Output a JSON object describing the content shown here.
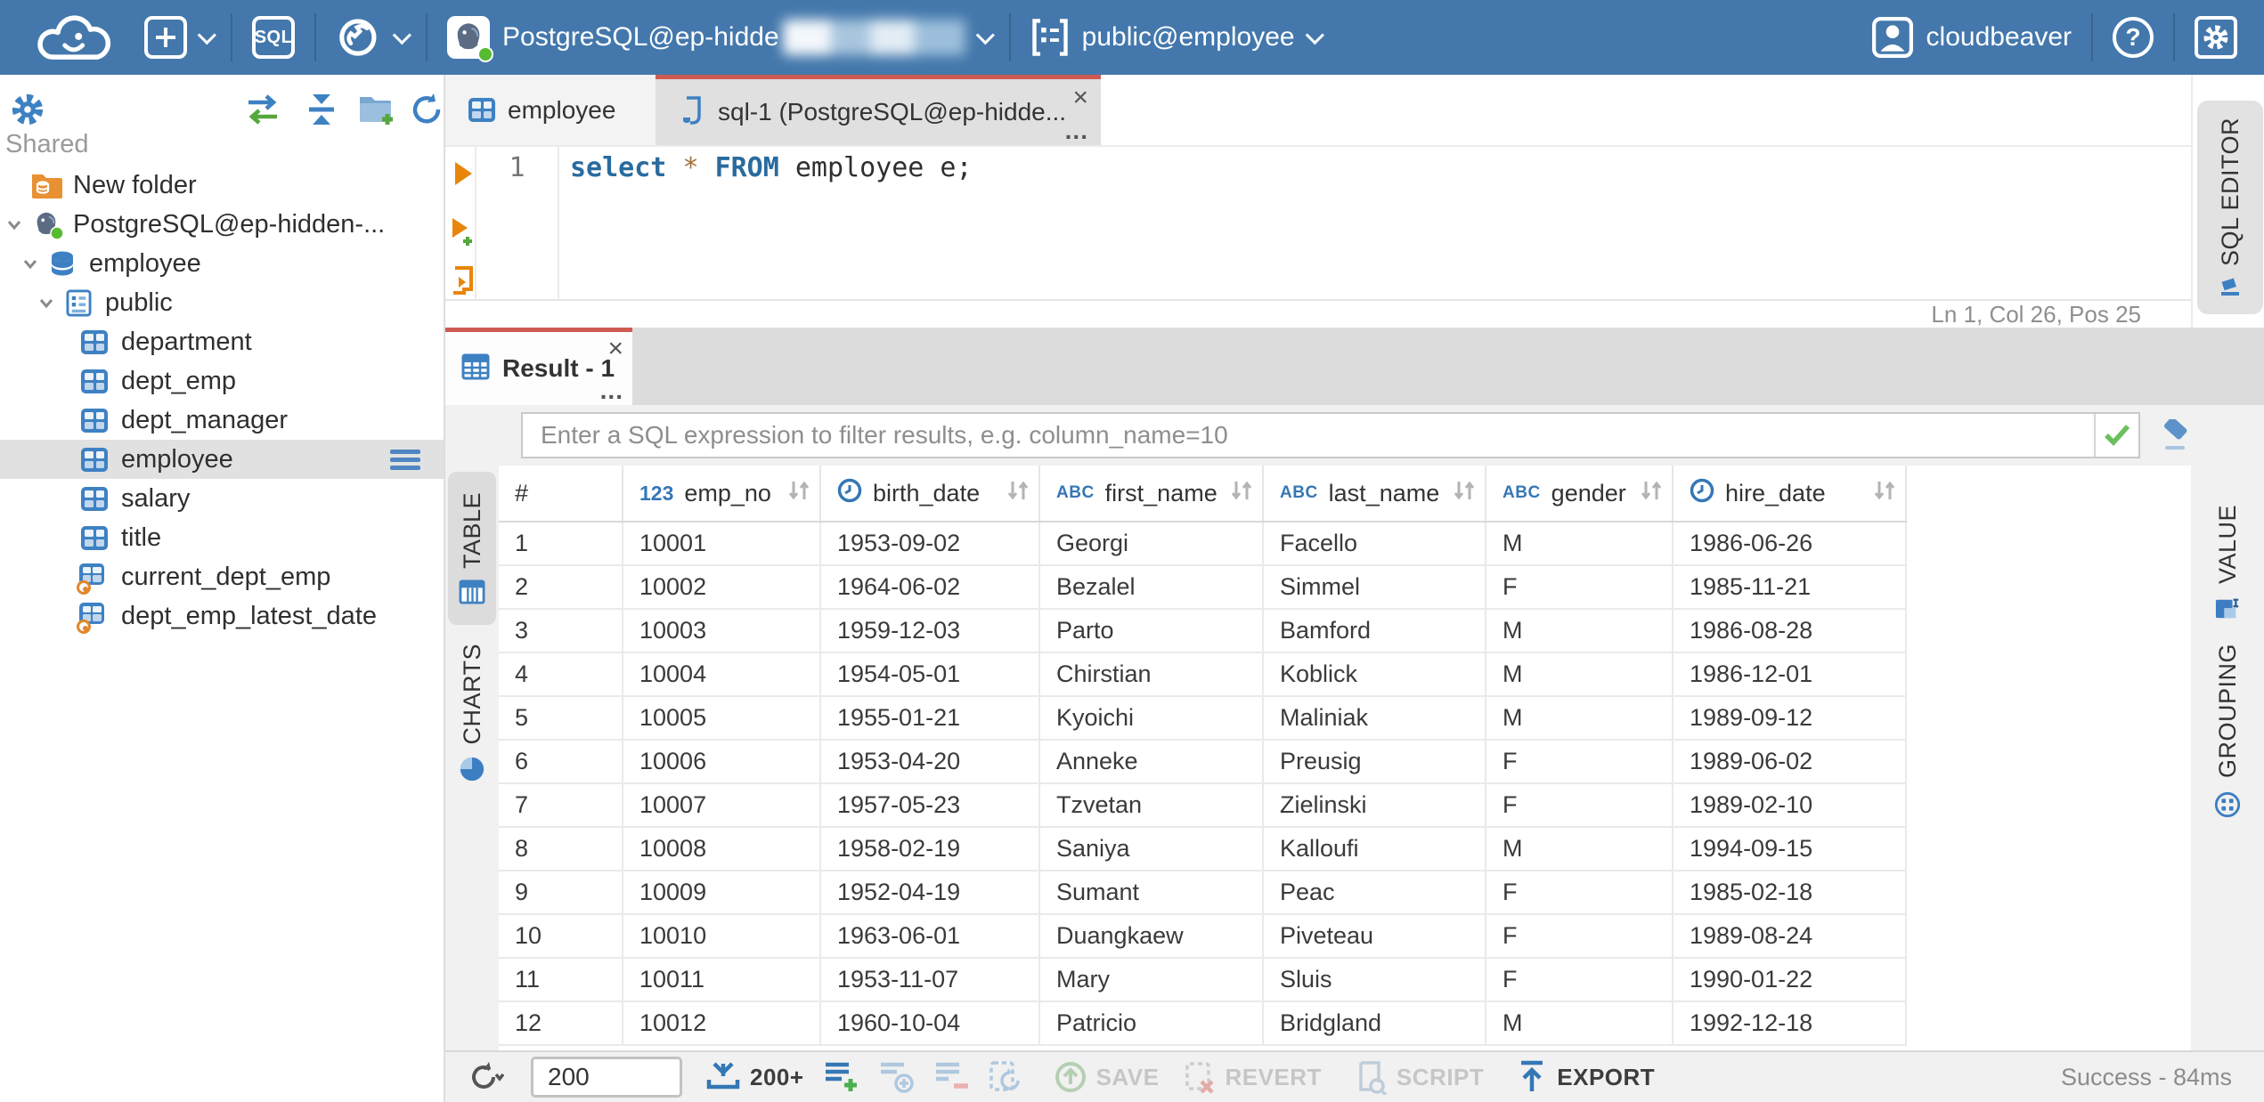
{
  "ui": {
    "close": "×",
    "more": "..."
  },
  "topbar": {
    "sql_button": "SQL",
    "connection_name": "PostgreSQL@ep-hidde",
    "schema_selector": "public@employee",
    "username": "cloudbeaver",
    "help": "?"
  },
  "sidebar": {
    "section": "Shared",
    "tree": [
      {
        "label": "New folder"
      },
      {
        "label": "PostgreSQL@ep-hidden-..."
      },
      {
        "label": "employee"
      },
      {
        "label": "public"
      },
      {
        "label": "department"
      },
      {
        "label": "dept_emp"
      },
      {
        "label": "dept_manager"
      },
      {
        "label": "employee"
      },
      {
        "label": "salary"
      },
      {
        "label": "title"
      },
      {
        "label": "current_dept_emp"
      },
      {
        "label": "dept_emp_latest_date"
      }
    ]
  },
  "editor_tabs": {
    "employee_tab": "employee",
    "sql_tab": "sql-1 (PostgreSQL@ep-hidde..."
  },
  "sql_editor": {
    "line_number": "1",
    "code": {
      "kw1": "select",
      "star": "*",
      "kw2": "FROM",
      "rest": "employee e;"
    },
    "status": "Ln 1, Col 26, Pos 25",
    "rail_label": "SQL EDITOR"
  },
  "result": {
    "tab_label": "Result - 1",
    "filter_placeholder": "Enter a SQL expression to filter results, e.g. column_name=10",
    "left_rail": {
      "table": "TABLE",
      "charts": "CHARTS"
    },
    "right_rail": {
      "value": "VALUE",
      "grouping": "GROUPING"
    }
  },
  "grid": {
    "number_badge": "123",
    "string_badge": "ABC",
    "columns": [
      {
        "name": "#",
        "type": "rownum"
      },
      {
        "name": "emp_no",
        "type": "number"
      },
      {
        "name": "birth_date",
        "type": "date"
      },
      {
        "name": "first_name",
        "type": "string"
      },
      {
        "name": "last_name",
        "type": "string"
      },
      {
        "name": "gender",
        "type": "string"
      },
      {
        "name": "hire_date",
        "type": "date"
      }
    ],
    "rows": [
      [
        "1",
        "10001",
        "1953-09-02",
        "Georgi",
        "Facello",
        "M",
        "1986-06-26"
      ],
      [
        "2",
        "10002",
        "1964-06-02",
        "Bezalel",
        "Simmel",
        "F",
        "1985-11-21"
      ],
      [
        "3",
        "10003",
        "1959-12-03",
        "Parto",
        "Bamford",
        "M",
        "1986-08-28"
      ],
      [
        "4",
        "10004",
        "1954-05-01",
        "Chirstian",
        "Koblick",
        "M",
        "1986-12-01"
      ],
      [
        "5",
        "10005",
        "1955-01-21",
        "Kyoichi",
        "Maliniak",
        "M",
        "1989-09-12"
      ],
      [
        "6",
        "10006",
        "1953-04-20",
        "Anneke",
        "Preusig",
        "F",
        "1989-06-02"
      ],
      [
        "7",
        "10007",
        "1957-05-23",
        "Tzvetan",
        "Zielinski",
        "F",
        "1989-02-10"
      ],
      [
        "8",
        "10008",
        "1958-02-19",
        "Saniya",
        "Kalloufi",
        "M",
        "1994-09-15"
      ],
      [
        "9",
        "10009",
        "1952-04-19",
        "Sumant",
        "Peac",
        "F",
        "1985-02-18"
      ],
      [
        "10",
        "10010",
        "1963-06-01",
        "Duangkaew",
        "Piveteau",
        "F",
        "1989-08-24"
      ],
      [
        "11",
        "10011",
        "1953-11-07",
        "Mary",
        "Sluis",
        "F",
        "1990-01-22"
      ],
      [
        "12",
        "10012",
        "1960-10-04",
        "Patricio",
        "Bridgland",
        "M",
        "1992-12-18"
      ]
    ]
  },
  "toolbar": {
    "row_limit": "200",
    "fetch_more": "200+",
    "save": "SAVE",
    "revert": "REVERT",
    "script": "SCRIPT",
    "export": "EXPORT",
    "status": "Success - 84ms"
  },
  "colors": {
    "topbar_blue": "#4478ac",
    "icon_blue": "#3e81c3",
    "active_tab_red": "#ce5a52",
    "status_green": "#55bb31"
  }
}
